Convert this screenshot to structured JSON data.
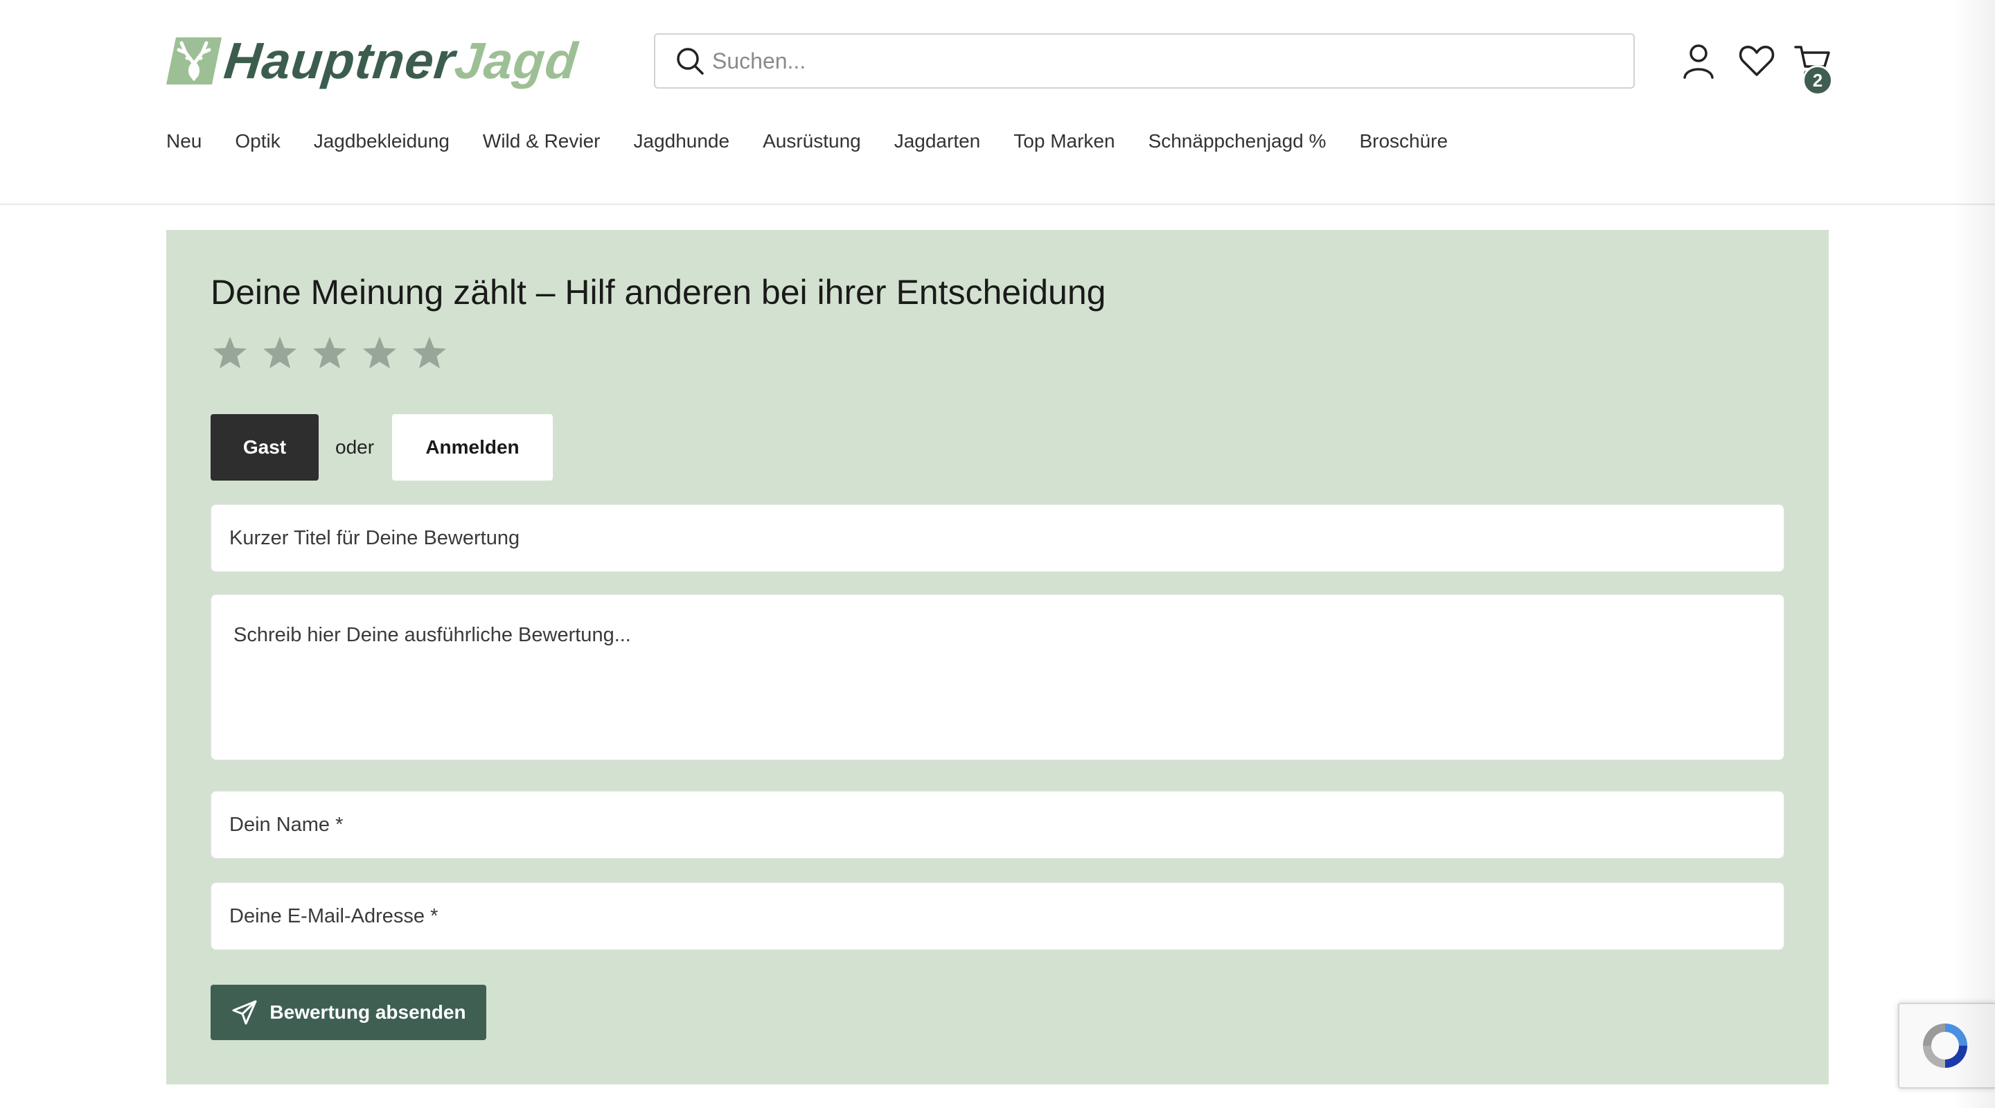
{
  "header": {
    "logo": {
      "word1": "Hauptner",
      "word2": "Jagd"
    },
    "search": {
      "placeholder": "Suchen..."
    },
    "icons": {
      "account": "user-icon",
      "wishlist": "heart-icon",
      "cart": "cart-icon"
    },
    "cart_count": "2"
  },
  "nav": {
    "items": [
      {
        "label": "Neu"
      },
      {
        "label": "Optik"
      },
      {
        "label": "Jagdbekleidung"
      },
      {
        "label": "Wild & Revier"
      },
      {
        "label": "Jagdhunde"
      },
      {
        "label": "Ausrüstung"
      },
      {
        "label": "Jagdarten"
      },
      {
        "label": "Top Marken"
      },
      {
        "label": "Schnäppchenjagd %"
      },
      {
        "label": "Broschüre"
      }
    ]
  },
  "review": {
    "title": "Deine Meinung zählt – Hilf anderen bei ihrer Entscheidung",
    "rating": {
      "value": 0,
      "max": 5
    },
    "guest_button": "Gast",
    "or_label": "oder",
    "login_button": "Anmelden",
    "fields": {
      "title_placeholder": "Kurzer Titel für Deine Bewertung",
      "text_placeholder": "Schreib hier Deine ausführliche Bewertung...",
      "name_placeholder": "Dein Name *",
      "email_placeholder": "Deine E-Mail-Adresse *"
    },
    "submit_button": "Bewertung absenden"
  },
  "colors": {
    "brand_dark": "#3c5d4e",
    "brand_light": "#9dbf95",
    "panel_bg": "#d3e2d0",
    "star_empty": "#9aa59a",
    "guest_btn": "#2e2e2e",
    "submit_btn": "#3f5f53"
  }
}
